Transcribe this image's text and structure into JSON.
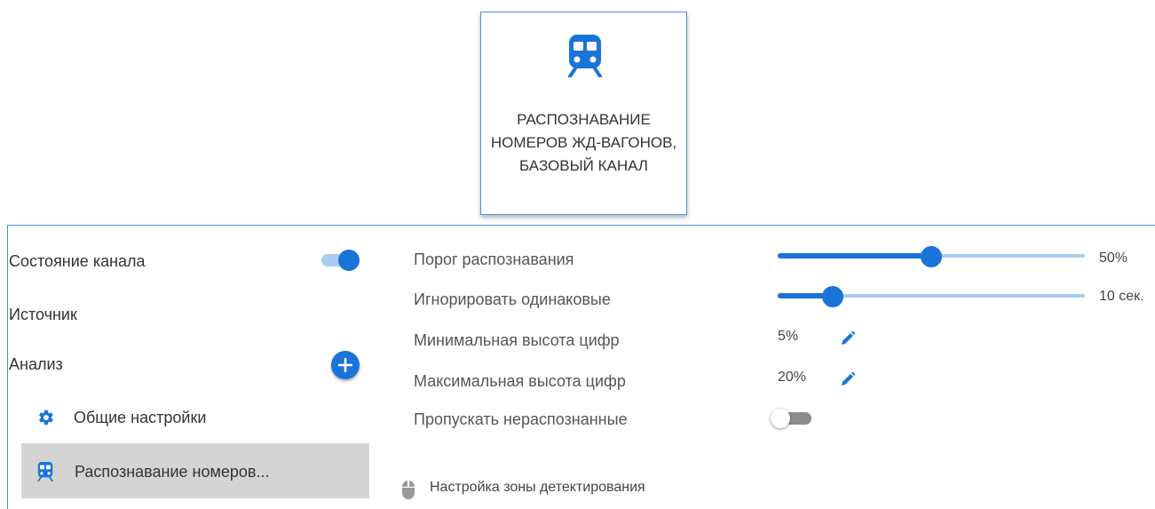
{
  "tile": {
    "icon": "train-icon",
    "title": "РАСПОЗНАВАНИЕ НОМЕРОВ ЖД-ВАГОНОВ, БАЗОВЫЙ КАНАЛ"
  },
  "left_panel": {
    "channel_state": {
      "label": "Состояние канала",
      "enabled": true
    },
    "source": {
      "label": "Источник"
    },
    "analysis": {
      "label": "Анализ",
      "add_icon": "plus-icon"
    },
    "sub_items": [
      {
        "label": "Общие настройки",
        "icon": "gear-icon"
      },
      {
        "label": "Распознавание номеров...",
        "icon": "train-icon",
        "selected": true
      }
    ]
  },
  "settings": {
    "recognition_threshold": {
      "label": "Порог распознавания",
      "value": 50,
      "value_text": "50%"
    },
    "ignore_identical": {
      "label": "Игнорировать одинаковые",
      "value_fraction": 0.18,
      "value_text": "10 сек."
    },
    "min_digit_height": {
      "label": "Минимальная высота цифр",
      "value_text": "5%",
      "edit_icon": "pencil-icon"
    },
    "max_digit_height": {
      "label": "Максимальная высота цифр",
      "value_text": "20%",
      "edit_icon": "pencil-icon"
    },
    "skip_unrecognized": {
      "label": "Пропускать нераспознанные",
      "enabled": false
    }
  },
  "zone_link": {
    "label": "Настройка зоны детектирования",
    "icon": "mouse-icon"
  },
  "colors": {
    "accent": "#1a73d9",
    "accent_light": "#a9cdf2",
    "selected_bg": "#d4d4d4"
  }
}
